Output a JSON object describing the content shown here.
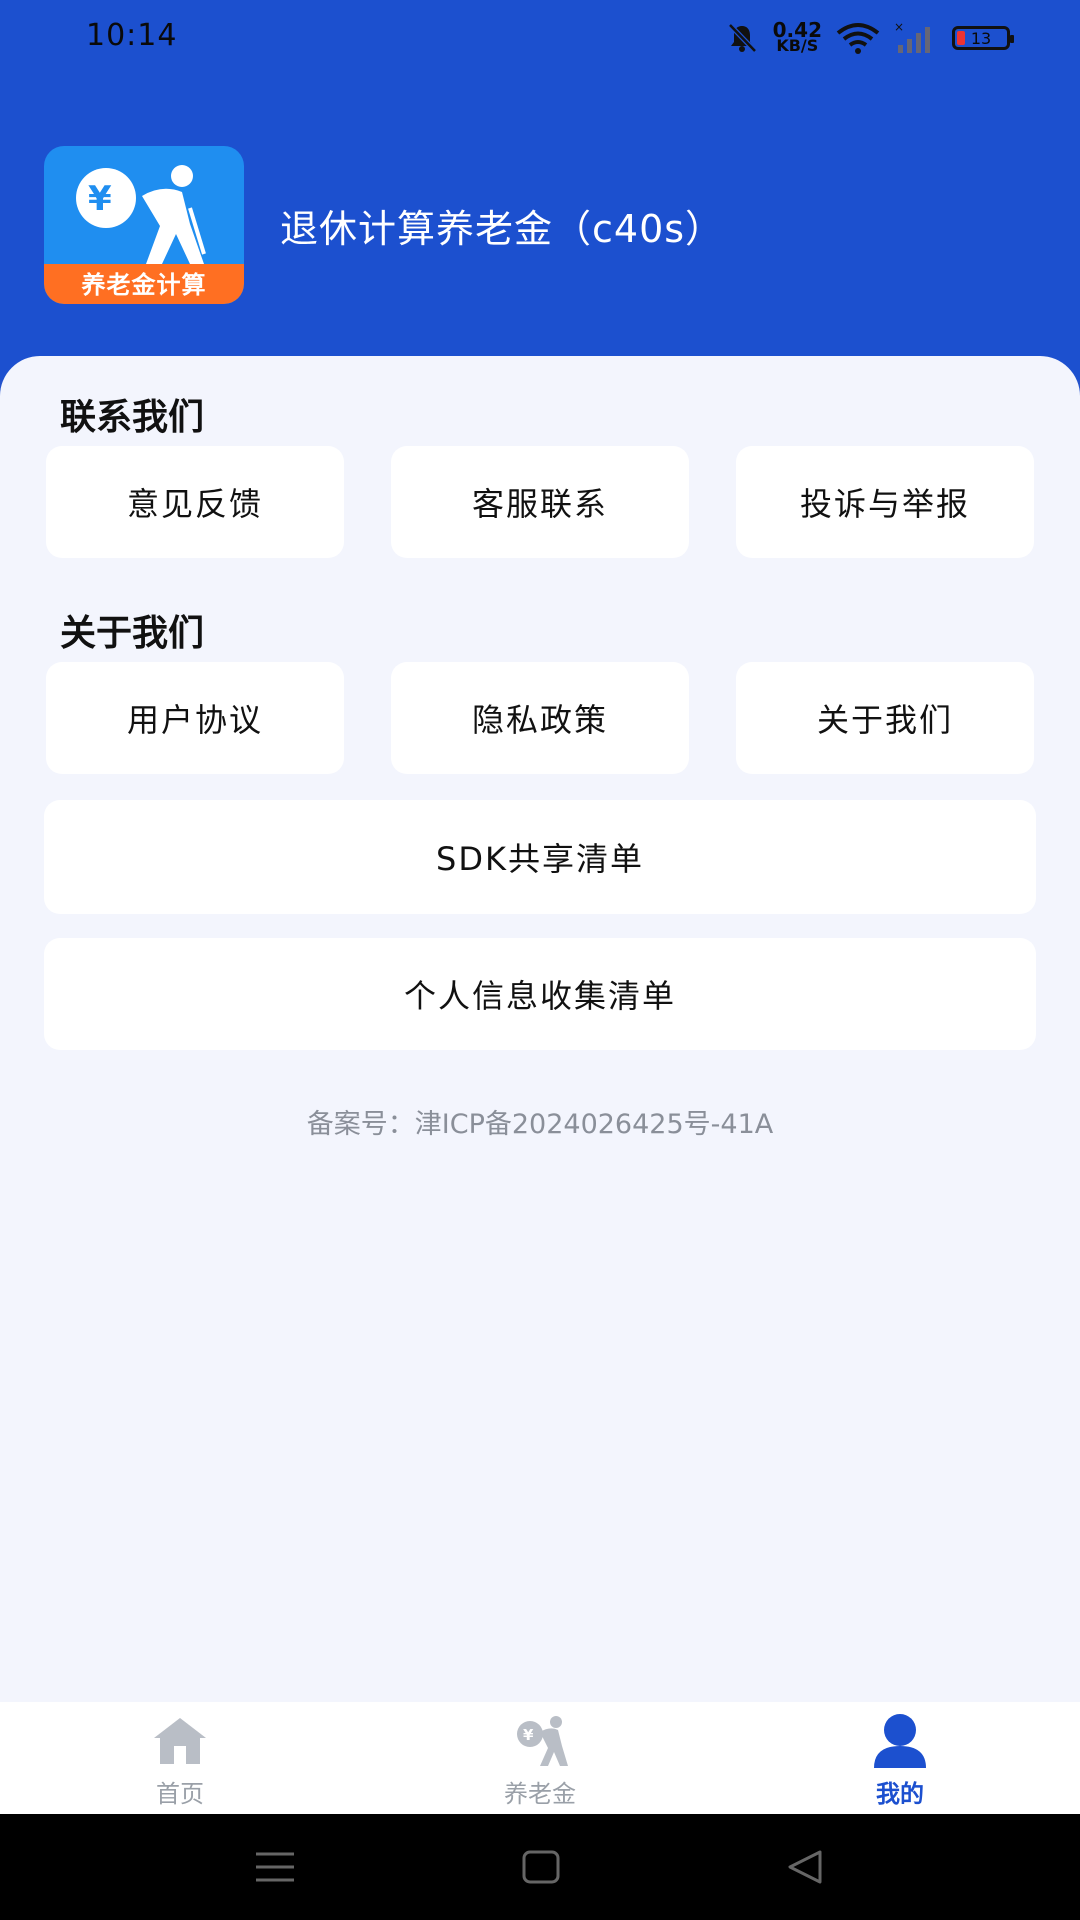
{
  "status_bar": {
    "time": "10:14",
    "net_speed_value": "0.42",
    "net_speed_unit": "KB/S",
    "battery_level": "13"
  },
  "header": {
    "app_title": "退休计算养老金（c40s）",
    "logo_text": "养老金计算"
  },
  "contact": {
    "title": "联系我们",
    "items": [
      "意见反馈",
      "客服联系",
      "投诉与举报"
    ]
  },
  "about": {
    "title": "关于我们",
    "items": [
      "用户协议",
      "隐私政策",
      "关于我们"
    ]
  },
  "lists": {
    "sdk": "SDK共享清单",
    "personal_info": "个人信息收集清单"
  },
  "icp": "备案号：津ICP备2024026425号-41A",
  "tabs": [
    {
      "label": "首页"
    },
    {
      "label": "养老金"
    },
    {
      "label": "我的"
    }
  ],
  "colors": {
    "brand_blue": "#1c50cf",
    "logo_orange": "#ff6f22",
    "background": "#f3f5fd"
  }
}
